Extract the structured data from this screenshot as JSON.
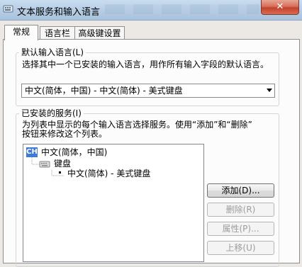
{
  "window": {
    "title": "文本服务和输入语言",
    "close_label": "✕"
  },
  "tabs": [
    {
      "label": "常规",
      "active": true
    },
    {
      "label": "语言栏",
      "active": false
    },
    {
      "label": "高级键设置",
      "active": false
    }
  ],
  "default_language": {
    "group_title": "默认输入语言(L)",
    "description": "选择其中一个已安装的输入语言，用作所有输入字段的默认语言。",
    "selected": "中文(简体，中国) - 中文(简体) - 美式键盘"
  },
  "installed_services": {
    "group_title": "已安装的服务(I)",
    "description_line1": "为列表中显示的每个输入语言选择服务。使用“添加”和“删除”",
    "description_line2": "按钮来修改这个列表。",
    "tree": {
      "language_badge": "CH",
      "language": "中文(简体，中国)",
      "category": "键盘",
      "item": "中文(简体) - 美式键盘"
    },
    "buttons": {
      "add": "添加(D)...",
      "remove": "删除(R)",
      "properties": "属性(P)...",
      "move_up": "上移(U)"
    }
  }
}
